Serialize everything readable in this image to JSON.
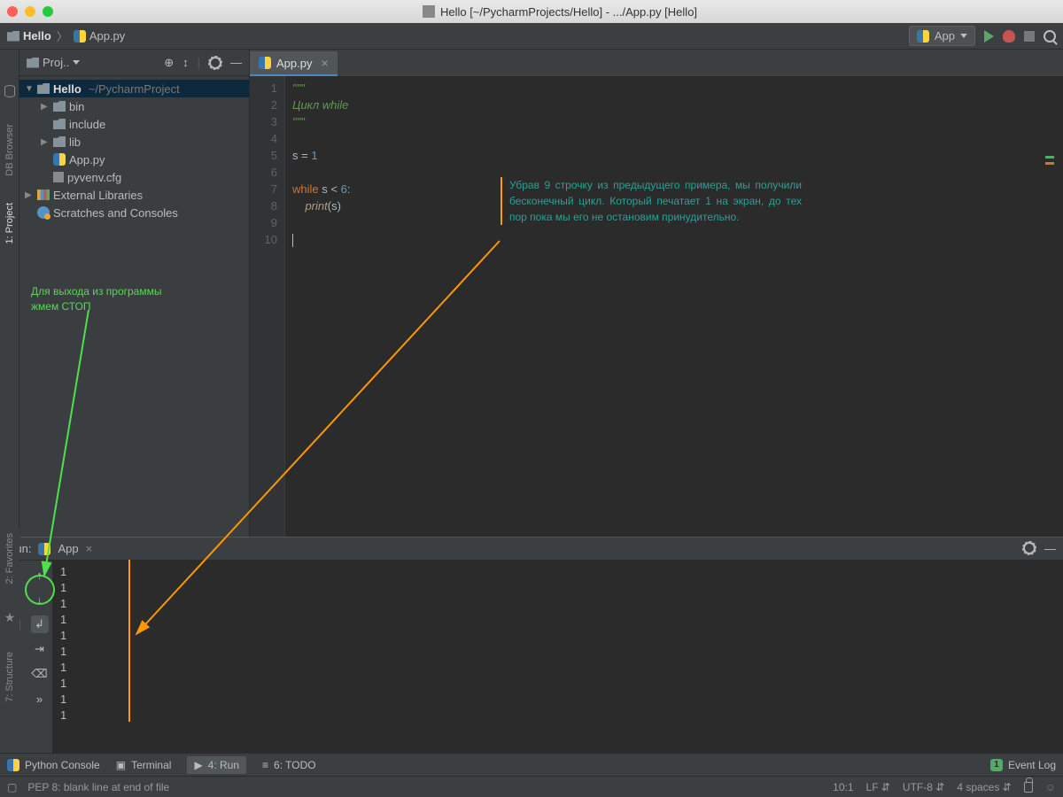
{
  "title": "Hello [~/PycharmProjects/Hello] - .../App.py [Hello]",
  "breadcrumb": {
    "root": "Hello",
    "file": "App.py"
  },
  "nav": {
    "run_config": "App"
  },
  "leftbar": {
    "project": "1: Project",
    "db": "DB Browser"
  },
  "sidebar": {
    "title": "Proj..",
    "tree": {
      "root": "Hello",
      "root_path": "~/PycharmProject",
      "bin": "bin",
      "include": "include",
      "lib": "lib",
      "app": "App.py",
      "pyvenv": "pyvenv.cfg",
      "ext": "External Libraries",
      "scratch": "Scratches and Consoles"
    }
  },
  "tab": {
    "name": "App.py"
  },
  "code": {
    "l1": "\"\"\"",
    "l2": "Цикл while",
    "l3": "\"\"\"",
    "l4": "",
    "l5_a": "s ",
    "l5_b": "= ",
    "l5_c": "1",
    "l7_a": "while",
    "l7_b": " s ",
    "l7_c": "< ",
    "l7_d": "6",
    "l7_e": ":",
    "l8_a": "print",
    "l8_b": "(s)",
    "lines": [
      "1",
      "2",
      "3",
      "4",
      "5",
      "6",
      "7",
      "8",
      "9",
      "10"
    ]
  },
  "annotation": {
    "orange": "Убрав 9 строчку из предыдущего примера, мы получили бесконечный цикл. Который печатает 1 на экран, до тех пор пока мы его не остановим принудительно.",
    "green": "Для выхода из программы жмем СТОП"
  },
  "run": {
    "label": "Run:",
    "config": "App",
    "output": [
      "1",
      "1",
      "1",
      "1",
      "1",
      "1",
      "1",
      "1",
      "1",
      "1"
    ]
  },
  "bottom_tabs": {
    "console": "Python Console",
    "terminal": "Terminal",
    "run": "4: Run",
    "todo": "6: TODO",
    "eventlog": "Event Log"
  },
  "statusbar": {
    "msg": "PEP 8: blank line at end of file",
    "pos": "10:1",
    "le": "LF",
    "enc": "UTF-8",
    "indent": "4 spaces"
  },
  "leftbar2": {
    "fav": "2: Favorites",
    "struct": "7: Structure"
  },
  "event_badge": "1"
}
